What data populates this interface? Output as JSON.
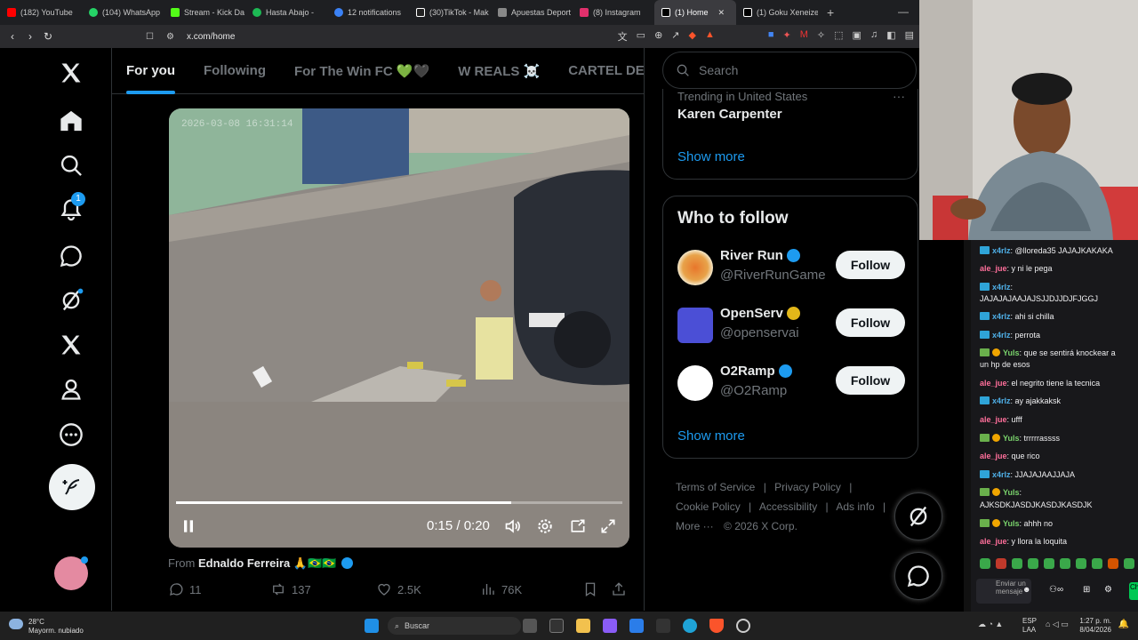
{
  "browser": {
    "tabs": [
      {
        "label": "(182) YouTube",
        "color": "#ff0000"
      },
      {
        "label": "(104) WhatsApp",
        "color": "#25d366"
      },
      {
        "label": "Stream - Kick Da",
        "color": "#53fc18"
      },
      {
        "label": "Hasta Abajo -",
        "color": "#1db954"
      },
      {
        "label": "12 notifications",
        "color": "#3b82f6"
      },
      {
        "label": "(30)TikTok - Mak",
        "color": "#ffffff"
      },
      {
        "label": "Apuestas Deport",
        "color": "#888888"
      },
      {
        "label": "(8) Instagram",
        "color": "#e1306c"
      },
      {
        "label": "(1) Home",
        "color": "#ffffff",
        "active": true
      },
      {
        "label": "(1) Goku Xeneize",
        "color": "#ffffff"
      }
    ],
    "url": "x.com/home"
  },
  "nav": {
    "notification_count": "1"
  },
  "feed": {
    "tabs": [
      "For you",
      "Following",
      "For The Win FC 💚🖤",
      "W REALS ☠️",
      "CARTEL DE LO"
    ],
    "video": {
      "timestamp_overlay": "2026-03-08 16:31:14",
      "time": "0:15 / 0:20",
      "progress": 0.75
    },
    "from_label": "From",
    "from_author": "Ednaldo Ferreira 🙏🇧🇷🇧🇷",
    "replies": "11",
    "reposts": "137",
    "likes": "2.5K",
    "views": "76K"
  },
  "sidebar": {
    "search_placeholder": "Search",
    "trend_context": "Trending in United States",
    "trend_name": "Karen Carpenter",
    "show_more": "Show more",
    "who_to_follow": "Who to follow",
    "follow_label": "Follow",
    "accounts": [
      {
        "name": "River Run",
        "handle": "@RiverRunGame",
        "verified": "blue"
      },
      {
        "name": "OpenServ",
        "handle": "@openservai",
        "verified": "gold"
      },
      {
        "name": "O2Ramp",
        "handle": "@O2Ramp",
        "verified": "blue"
      }
    ],
    "footer": {
      "terms": "Terms of Service",
      "privacy": "Privacy Policy",
      "cookie": "Cookie Policy",
      "accessibility": "Accessibility",
      "ads": "Ads info",
      "more": "More ···",
      "copyright": "© 2026 X Corp."
    }
  },
  "chat": {
    "messages": [
      {
        "user": "x4rlz",
        "text": ": @lloreda35 JAJAJKAKAKA"
      },
      {
        "user": "ale_jue",
        "text": ": y ni le pega"
      },
      {
        "user": "x4rlz",
        "text": ":"
      },
      {
        "user": "",
        "text": "JAJAJAJAAJAJSJJDJJDJFJGGJ"
      },
      {
        "user": "x4rlz",
        "text": ": ahi si chilla"
      },
      {
        "user": "x4rlz",
        "text": ": perrota"
      },
      {
        "user": "Yuls",
        "text": ": que se sentirá knockear a"
      },
      {
        "user": "",
        "text": "un hp de esos"
      },
      {
        "user": "ale_jue",
        "text": ": el negrito tiene la tecnica"
      },
      {
        "user": "x4rlz",
        "text": ": ay ajakkaksk"
      },
      {
        "user": "ale_jue",
        "text": ": ufff"
      },
      {
        "user": "Yuls",
        "text": ": trrrrrassss"
      },
      {
        "user": "ale_jue",
        "text": ": que rico"
      },
      {
        "user": "x4rlz",
        "text": ": JJAJAJAAJJAJA"
      },
      {
        "user": "Yuls",
        "text": ":"
      },
      {
        "user": "",
        "text": "AJKSDKJASDJKASDJKASDJK"
      },
      {
        "user": "Yuls",
        "text": ": ahhh no"
      },
      {
        "user": "ale_jue",
        "text": ": y llora la loquita"
      }
    ],
    "input_placeholder": "Enviar un mensaje",
    "send": "Ch"
  },
  "taskbar": {
    "temp": "28°C",
    "weather": "Mayorm. nubiado",
    "search": "Buscar",
    "lang1": "ESP",
    "lang2": "LAA",
    "time": "1:27 p. m.",
    "date": "8/04/2026"
  }
}
